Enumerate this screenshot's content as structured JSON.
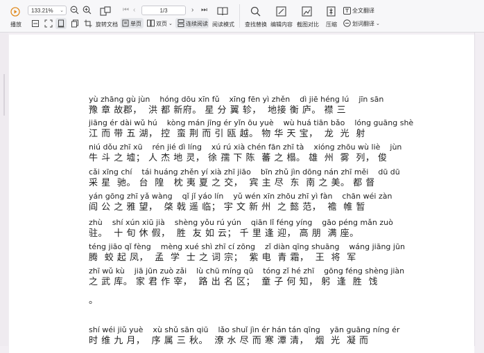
{
  "toolbar": {
    "zoom_value": "133.21%",
    "page_indicator": "1/3",
    "labels": {
      "play": "播放",
      "rotate": "旋转文档",
      "single": "单页",
      "double": "双页",
      "continuous": "连续阅读",
      "reading_mode": "阅读模式",
      "find_replace": "查找替换",
      "edit_content": "编辑内容",
      "screenshot_compare": "截图对比",
      "compress": "压缩",
      "full_translate": "全文翻译",
      "word_translate": "划词翻译"
    }
  },
  "document": {
    "lines": [
      {
        "py": "yù zhāng gù jùn    hóng dōu xīn fǔ    xīng fēn yì zhěn    dì jiē héng lú    jīn sān",
        "hz": "豫 章 故郡，  洪 都 新府。 星 分 翼 轸，  地接 衡 庐。 襟 三"
      },
      {
        "py": "jiāng ér dài wǔ hú    kòng mán jīng ér yǐn ōu yuè    wù huá tiān bǎo    lóng guāng shè",
        "hz": "江 而 带 五 湖， 控  蛮 荆 而 引 瓯 越。 物 华 天 宝，  龙  光  射"
      },
      {
        "py": "niú dǒu zhī xū    rén jié dì líng    xú rú xià chén fān zhī tà    xióng zhōu wù liè    jùn",
        "hz": "牛 斗 之 墟； 人 杰 地 灵， 徐 孺 下 陈  蕃 之 榻。 雄  州  雾  列， 俊"
      },
      {
        "py": "cǎi xīng chí    tái huáng zhěn yí xià zhī jiāo    bīn zhǔ jìn dōng nán zhī měi    dū dū",
        "hz": "采 星  驰。 台  隍   枕 夷 夏 之 交，  宾 主 尽  东  南 之 美。 都 督"
      },
      {
        "py": "yán gōng zhī yǎ wàng    qǐ jǐ yáo lín    yǔ wén xīn zhōu zhī yì fàn    chān wéi zàn",
        "hz": "阎 公 之 雅 望，  棨 戟 遥 临； 宇 文 新 州  之 懿 范，  襜  帷 暂"
      },
      {
        "py": "zhù    shí xún xiū jià    shèng yǒu rú yún    qiān lǐ féng yíng    gāo péng mǎn zuò",
        "hz": "驻。  十 旬 休 假，  胜  友 如 云； 千 里 逢 迎， 高 朋  满 座。"
      },
      {
        "py": "téng jiāo qǐ fèng    mèng xué shì zhī cí zōng    zǐ diàn qīng shuāng    wáng jiāng jūn",
        "hz": "腾  蛟 起 凤，  孟  学  士 之 词 宗；  紫 电  青 霜，  王  将  军"
      },
      {
        "py": "zhī wǔ kù    jiā jūn zuò zǎi    lù chū míng qū    tóng zǐ hé zhī    gōng féng shèng jiàn",
        "hz": "之 武 库。 家 君 作 宰，  路 出 名 区；  童 子 何 知， 躬  逢  胜  饯"
      },
      {
        "py": "",
        "hz": "。"
      },
      {
        "py": "",
        "hz": ""
      },
      {
        "py": "shí wéi jiǔ yuè    xù shǔ sān qiū    lǎo shuǐ jìn ér hán tán qīng    yān guāng níng ér",
        "hz": "时 维 九 月，  序 属 三 秋。  潦 水 尽 而 寒 潭 清，  烟  光  凝 而"
      }
    ]
  }
}
